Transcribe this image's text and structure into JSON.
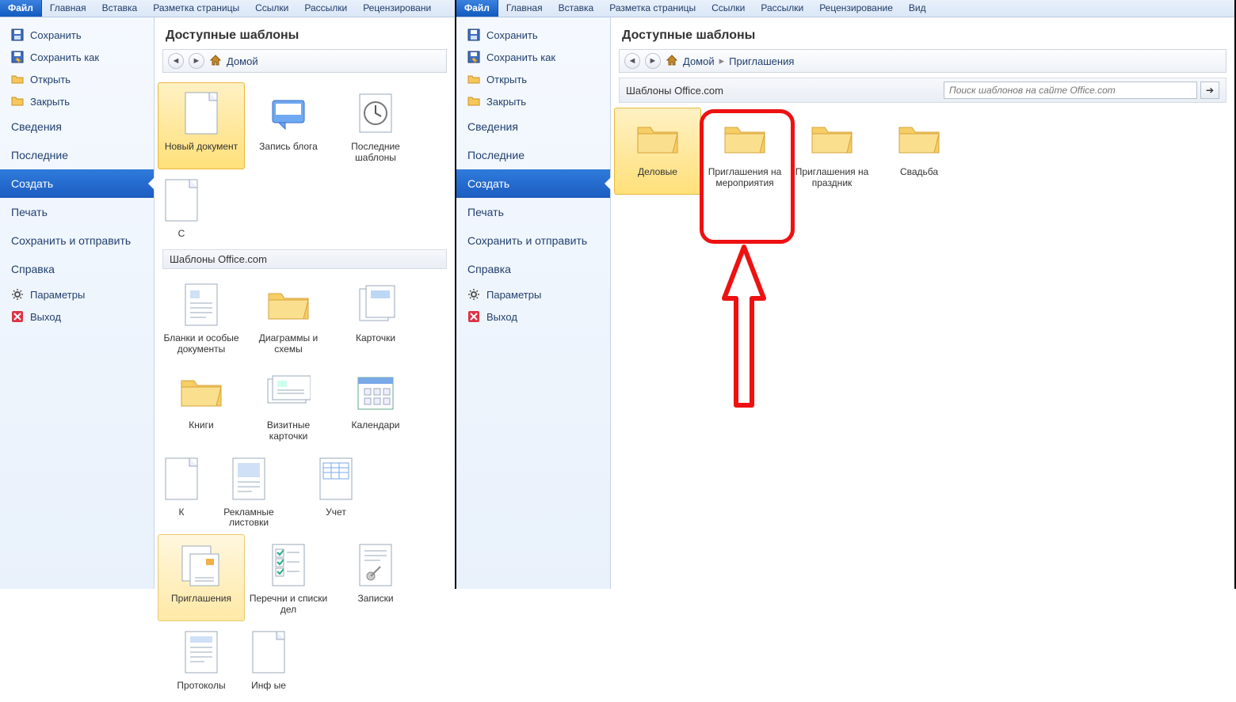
{
  "ribbon": [
    "Файл",
    "Главная",
    "Вставка",
    "Разметка страницы",
    "Ссылки",
    "Рассылки",
    "Рецензирование",
    "Вид"
  ],
  "ribbon_left_cut": [
    "Файл",
    "Главная",
    "Вставка",
    "Разметка страницы",
    "Ссылки",
    "Рассылки",
    "Рецензировани"
  ],
  "sidebar": {
    "save": "Сохранить",
    "saveas": "Сохранить как",
    "open": "Открыть",
    "close": "Закрыть",
    "info": "Сведения",
    "recent": "Последние",
    "new": "Создать",
    "print": "Печать",
    "share": "Сохранить и отправить",
    "help": "Справка",
    "options": "Параметры",
    "exit": "Выход"
  },
  "content_title": "Доступные шаблоны",
  "breadcrumb_home": "Домой",
  "breadcrumb_inv": "Приглашения",
  "office_section": "Шаблоны Office.com",
  "search_placeholder": "Поиск шаблонов на сайте Office.com",
  "left_top_tiles": [
    {
      "k": "newdoc",
      "label": "Новый документ",
      "sel": true,
      "icon": "doc"
    },
    {
      "k": "blog",
      "label": "Запись блога",
      "icon": "blog"
    },
    {
      "k": "recenttpl",
      "label": "Последние шаблоны",
      "icon": "clock"
    },
    {
      "k": "partial1",
      "label": "С",
      "icon": "doc",
      "partial": true
    }
  ],
  "left_office_tiles": [
    {
      "k": "blanks",
      "label": "Бланки и особые документы",
      "icon": "doc-lines"
    },
    {
      "k": "diagrams",
      "label": "Диаграммы и схемы",
      "icon": "folder"
    },
    {
      "k": "cards",
      "label": "Карточки",
      "icon": "card"
    },
    {
      "k": "books",
      "label": "Книги",
      "icon": "folder"
    },
    {
      "k": "bizcards",
      "label": "Визитные карточки",
      "icon": "bizcard"
    },
    {
      "k": "calendars",
      "label": "Календари",
      "icon": "calendar"
    },
    {
      "k": "partial2",
      "label": "К",
      "icon": "doc",
      "partial": true
    },
    {
      "k": "flyers",
      "label": "Рекламные листовки",
      "icon": "flyer"
    },
    {
      "k": "accounting",
      "label": "Учет",
      "icon": "table"
    },
    {
      "k": "invitations",
      "label": "Приглашения",
      "icon": "invite",
      "hov": true
    },
    {
      "k": "lists",
      "label": "Перечни и списки дел",
      "icon": "checklist"
    },
    {
      "k": "notes",
      "label": "Записки",
      "icon": "pin"
    },
    {
      "k": "protocols",
      "label": "Протоколы",
      "icon": "protocol"
    },
    {
      "k": "partial3",
      "label": "Инф ые",
      "icon": "doc",
      "partial": true
    }
  ],
  "tooltip_invite": "Приглашения",
  "right_tiles": [
    {
      "k": "biz",
      "label": "Деловые",
      "sel": true
    },
    {
      "k": "events",
      "label": "Приглашения на мероприятия"
    },
    {
      "k": "holiday",
      "label": "Приглашения на праздник"
    },
    {
      "k": "wedding",
      "label": "Свадьба"
    }
  ]
}
